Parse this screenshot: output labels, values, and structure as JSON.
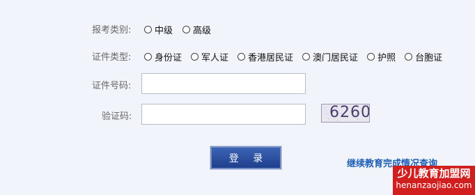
{
  "form": {
    "category": {
      "label": "报考类别:",
      "options": [
        {
          "text": "中级",
          "selected": false
        },
        {
          "text": "高级",
          "selected": false
        }
      ]
    },
    "id_type": {
      "label": "证件类型:",
      "options": [
        {
          "text": "身份证",
          "selected": false
        },
        {
          "text": "军人证",
          "selected": false
        },
        {
          "text": "香港居民证",
          "selected": false
        },
        {
          "text": "澳门居民证",
          "selected": false
        },
        {
          "text": "护照",
          "selected": false
        },
        {
          "text": "台胞证",
          "selected": false
        }
      ]
    },
    "id_number": {
      "label": "证件号码:",
      "value": ""
    },
    "captcha": {
      "label": "验证码:",
      "value": "",
      "image_text": "6260"
    },
    "login_label": "登 录",
    "query_link_label": "继续教育完成情况查询"
  },
  "watermark": {
    "line1": "少儿教育加盟网",
    "line2": "henanzaojiao.com"
  },
  "colors": {
    "background": "#f1f4fb",
    "button": "#2a4c9c",
    "link": "#1f5fb5",
    "watermark": "#d11f1f"
  }
}
